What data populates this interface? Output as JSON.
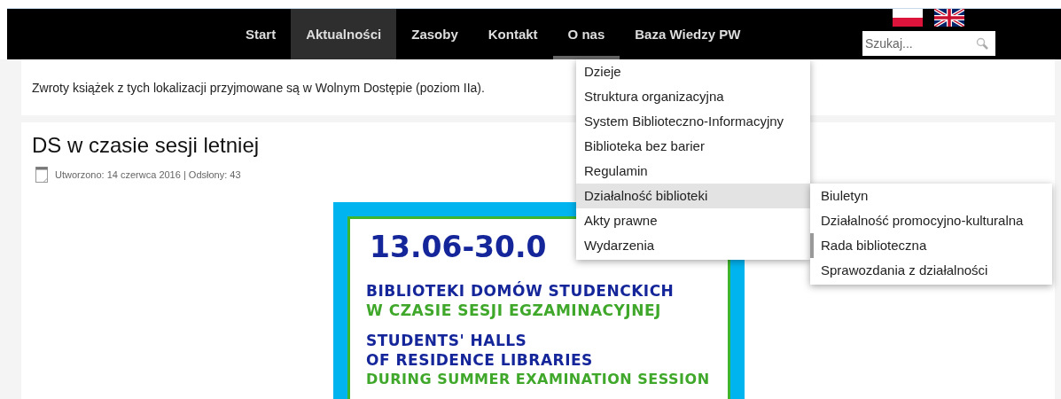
{
  "nav": {
    "items": [
      {
        "label": "Start",
        "selected": false,
        "expanded": false
      },
      {
        "label": "Aktualności",
        "selected": true,
        "expanded": false
      },
      {
        "label": "Zasoby",
        "selected": false,
        "expanded": false
      },
      {
        "label": "Kontakt",
        "selected": false,
        "expanded": false
      },
      {
        "label": "O nas",
        "selected": false,
        "expanded": true
      },
      {
        "label": "Baza Wiedzy PW",
        "selected": false,
        "expanded": false
      }
    ]
  },
  "languages": [
    {
      "kind": "pl"
    },
    {
      "kind": "en"
    }
  ],
  "search": {
    "placeholder": "Szukaj..."
  },
  "notice": "Zwroty książek z tych lokalizacji przyjmowane są w Wolnym Dostępie (poziom IIa).",
  "article": {
    "title": "DS w czasie sesji letniej",
    "meta": "Utworzono: 14 czerwca 2016 | Odsłony: 43",
    "poster": {
      "lines": [
        {
          "kind": "date",
          "text": "13.06-30.0"
        },
        {
          "kind": "blue",
          "text": "BIBLIOTEKI DOMÓW STUDENCKICH"
        },
        {
          "kind": "green",
          "text": "W CZASIE SESJI EGZAMINACYJNEJ"
        },
        {
          "kind": "blue",
          "text": "STUDENTS' HALLS"
        },
        {
          "kind": "blue",
          "text": "OF RESIDENCE LIBRARIES"
        },
        {
          "kind": "green",
          "text": "DURING SUMMER EXAMINATION SESSION"
        }
      ]
    }
  },
  "dropdown": {
    "items": [
      {
        "label": "Dzieje",
        "selected": false
      },
      {
        "label": "Struktura organizacyjna",
        "selected": false
      },
      {
        "label": "System Biblioteczno-Informacyjny",
        "selected": false
      },
      {
        "label": "Biblioteka bez barier",
        "selected": false
      },
      {
        "label": "Regulamin",
        "selected": false
      },
      {
        "label": "Działalność biblioteki",
        "selected": true
      },
      {
        "label": "Akty prawne",
        "selected": false
      },
      {
        "label": "Wydarzenia",
        "selected": false
      }
    ]
  },
  "submenu": {
    "items": [
      {
        "label": "Biuletyn",
        "selected": false
      },
      {
        "label": "Działalność promocyjno-kulturalna",
        "selected": false
      },
      {
        "label": "Rada biblioteczna",
        "selected": true
      },
      {
        "label": "Sprawozdania z działalności",
        "selected": false
      }
    ]
  }
}
